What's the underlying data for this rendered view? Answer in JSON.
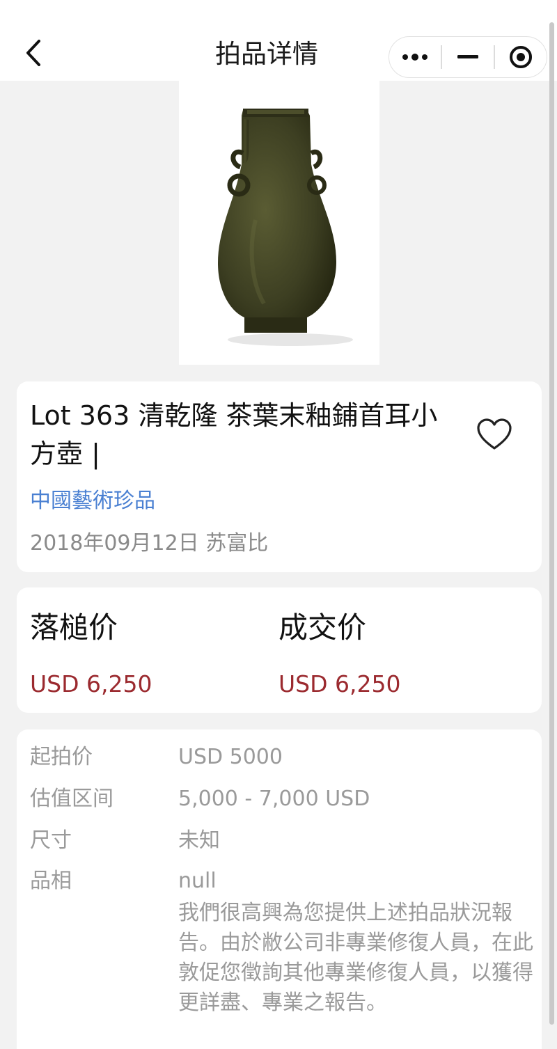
{
  "nav": {
    "title": "拍品详情",
    "back_icon": "chevron-left-icon",
    "more_icon": "more-dots-icon",
    "minimize_icon": "minimize-icon",
    "close_icon": "target-circle-icon"
  },
  "lot": {
    "title": "Lot 363 清乾隆 茶葉末釉鋪首耳小方壺 |",
    "category": "中國藝術珍品",
    "date_house": "2018年09月12日 苏富比",
    "favorite_icon": "heart-outline-icon"
  },
  "prices": {
    "hammer_label": "落槌价",
    "hammer_value": "USD 6,250",
    "final_label": "成交价",
    "final_value": "USD 6,250"
  },
  "details": {
    "rows": [
      {
        "label": "起拍价",
        "value": "USD 5000"
      },
      {
        "label": "估值区间",
        "value": "5,000 - 7,000 USD"
      },
      {
        "label": "尺寸",
        "value": "未知"
      },
      {
        "label": "品相",
        "value": "null"
      }
    ],
    "condition_note": "我們很高興為您提供上述拍品狀況報告。由於敝公司非專業修復人員，在此敦促您徵詢其他專業修復人員，以獲得更詳盡、專業之報告。"
  },
  "colors": {
    "accent_link": "#4a80d2",
    "price_red": "#9b2a2f",
    "background": "#f2f2f2",
    "vase_glaze": "#3d3f22"
  }
}
